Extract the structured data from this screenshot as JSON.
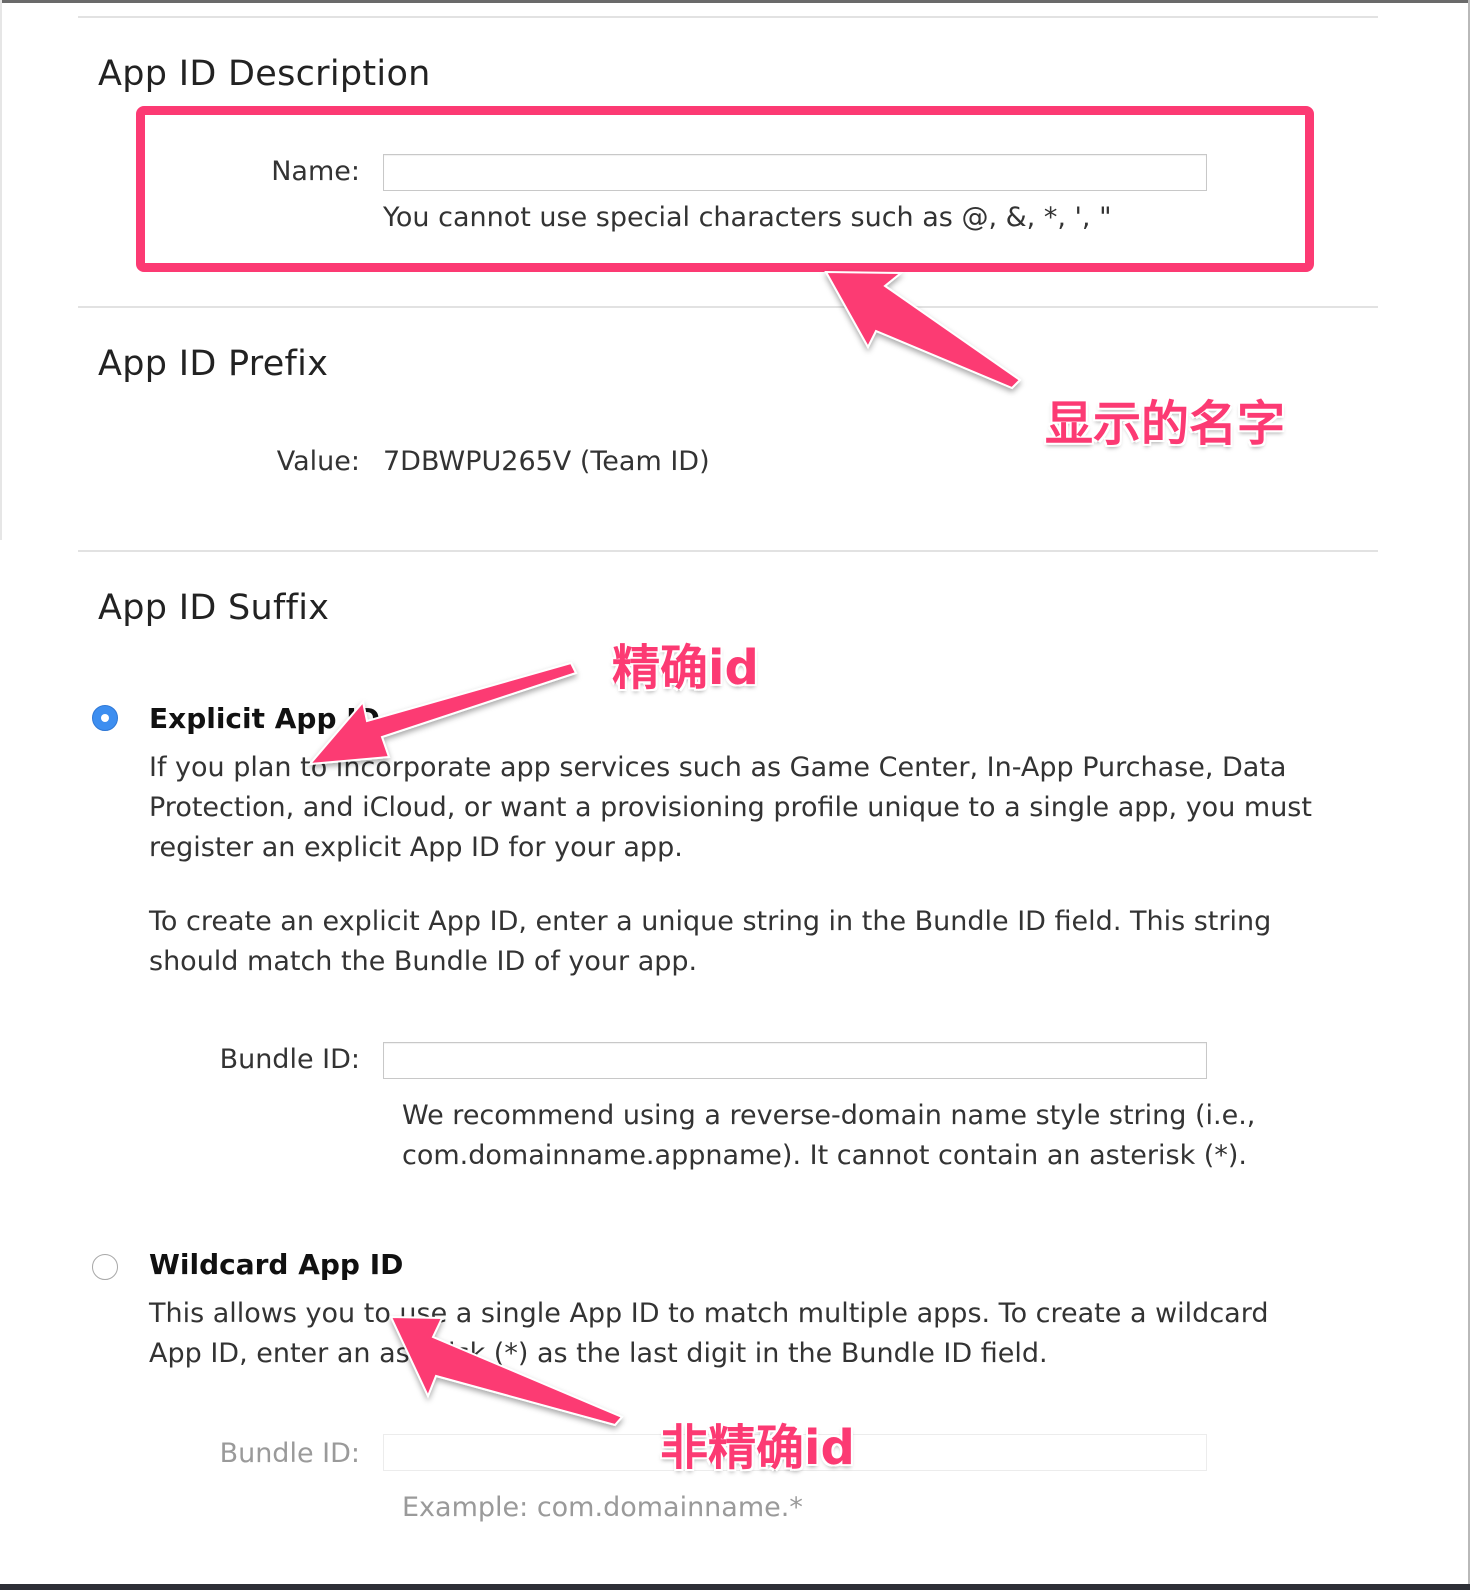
{
  "sections": {
    "description": {
      "title": "App ID Description",
      "name_label": "Name:",
      "name_value": "",
      "name_hint": "You cannot use special characters such as @, &, *, ', \""
    },
    "prefix": {
      "title": "App ID Prefix",
      "value_label": "Value:",
      "value": "7DBWPU265V (Team ID)"
    },
    "suffix": {
      "title": "App ID Suffix",
      "explicit": {
        "label": "Explicit App ID",
        "selected": true,
        "para1": "If you plan to incorporate app services such as Game Center, In-App Purchase, Data Protection, and iCloud, or want a provisioning profile unique to a single app, you must register an explicit App ID for your app.",
        "para2": "To create an explicit App ID, enter a unique string in the Bundle ID field. This string should match the Bundle ID of your app.",
        "bundle_label": "Bundle ID:",
        "bundle_value": "",
        "bundle_hint": "We recommend using a reverse-domain name style string (i.e., com.domainname.appname). It cannot contain an asterisk (*)."
      },
      "wildcard": {
        "label": "Wildcard App ID",
        "selected": false,
        "para": "This allows you to use a single App ID to match multiple apps. To create a wildcard App ID, enter an asterisk (*) as the last digit in the Bundle ID field.",
        "bundle_label": "Bundle ID:",
        "bundle_value": "",
        "bundle_placeholder": "",
        "bundle_hint": "Example: com.domainname.*"
      }
    }
  },
  "annotations": {
    "display_name": "显示的名字",
    "explicit_id": "精确id",
    "wildcard_id": "非精确id",
    "color": "#fc3a73"
  },
  "colors": {
    "accent_radio": "#3d8ef0",
    "text": "#333333",
    "disabled_text": "#9a9a9a"
  }
}
